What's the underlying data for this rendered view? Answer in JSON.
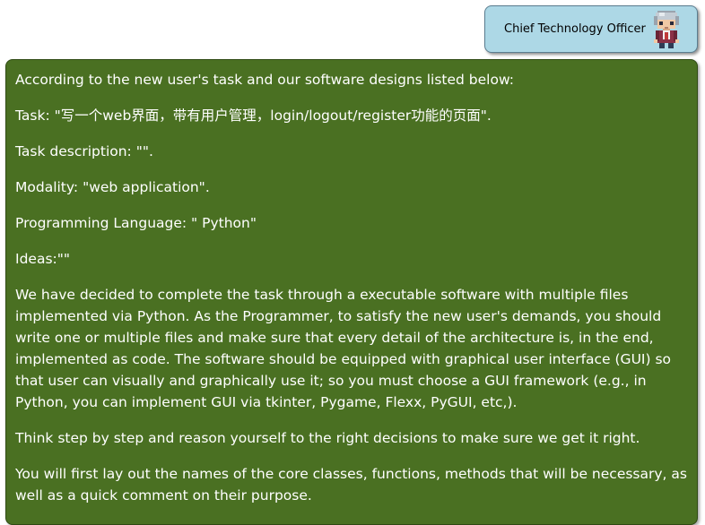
{
  "role": {
    "label": "Chief Technology Officer",
    "icon": "pixel-avatar-icon",
    "color": "#add8e6"
  },
  "message": {
    "background": "#4a7022",
    "paragraphs": [
      "According to the new user's task and our software designs listed below:",
      "Task: \"写一个web界面，带有用户管理，login/logout/register功能的页面\".",
      "Task description: \"\".",
      "Modality: \"web application\".",
      "Programming Language: \" Python\"",
      "Ideas:\"\"",
      "We have decided to complete the task through a executable software with multiple files implemented via Python. As the Programmer, to satisfy the new user's demands, you should write one or multiple files and make sure that every detail of the architecture is, in the end, implemented as code. The software should be equipped with graphical user interface (GUI) so that user can visually and graphically use it; so you must choose a GUI framework (e.g., in Python, you can implement GUI via tkinter, Pygame, Flexx, PyGUI, etc,).",
      "Think step by step and reason yourself to the right decisions to make sure we get it right.",
      "You will first lay out the names of the core classes, functions, methods that will be necessary, as well as a quick comment on their purpose."
    ]
  }
}
